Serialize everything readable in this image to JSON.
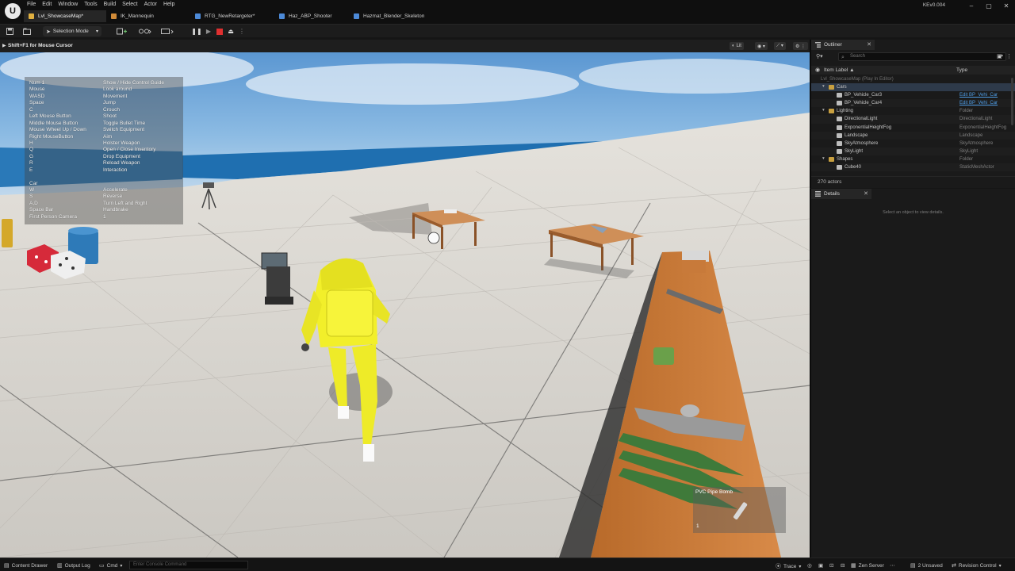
{
  "app": {
    "logo": "U",
    "version": "KEv0.004"
  },
  "menu": [
    "File",
    "Edit",
    "Window",
    "Tools",
    "Build",
    "Select",
    "Actor",
    "Help"
  ],
  "tabs": [
    {
      "label": "Lvl_ShowcaseMap*",
      "icon_color": "#e0b040"
    },
    {
      "label": "IK_Mannequin",
      "icon_color": "#d08a38"
    },
    {
      "label": "RTG_NewRetargeter*",
      "icon_color": "#4c8ad8"
    },
    {
      "label": "Haz_ABP_Shooter",
      "icon_color": "#4c8ad8"
    },
    {
      "label": "Hazmat_Blender_Skeleton",
      "icon_color": "#4c8ad8"
    }
  ],
  "window_controls": {
    "minimize": "–",
    "maximize": "▢",
    "close": "✕"
  },
  "toolbar": {
    "selection_mode": "Selection Mode"
  },
  "viewport": {
    "hint": "Shift+F1 for Mouse Cursor",
    "view_mode": "Lit"
  },
  "control_guide": [
    {
      "key": "Num 1",
      "action": "Show / Hide Control Guide"
    },
    {
      "key": "Mouse",
      "action": "Look around"
    },
    {
      "key": "WASD",
      "action": "Movement"
    },
    {
      "key": "Space",
      "action": "Jump"
    },
    {
      "key": "C",
      "action": "Crouch"
    },
    {
      "key": "Left Mouse Button",
      "action": "Shoot"
    },
    {
      "key": "Middle Mouse Button",
      "action": "Toggle Bullet Time"
    },
    {
      "key": "Mouse Wheel Up / Down",
      "action": "Switch Equipment"
    },
    {
      "key": "Right MouseButton",
      "action": "Aim"
    },
    {
      "key": "H",
      "action": "Holster Weapon"
    },
    {
      "key": "Q",
      "action": "Open / Close Inventory"
    },
    {
      "key": "G",
      "action": "Drop Equipment"
    },
    {
      "key": "R",
      "action": "Reload Weapon"
    },
    {
      "key": "E",
      "action": "Interaction"
    },
    {
      "key": "",
      "action": ""
    },
    {
      "key": "Car",
      "action": ""
    },
    {
      "key": "W",
      "action": "Accelerate"
    },
    {
      "key": "S",
      "action": "Reverse"
    },
    {
      "key": "A,D",
      "action": "Turn Left and Right"
    },
    {
      "key": "Space Bar",
      "action": "Handbrake"
    },
    {
      "key": "First Person Camera",
      "action": "1"
    }
  ],
  "pickup": {
    "name": "PVC Pipe Bomb",
    "count": "1"
  },
  "outliner": {
    "title": "Outliner",
    "search_placeholder": "Search",
    "col_label": "Item Label ▲",
    "col_type": "Type",
    "footer": "270 actors",
    "rows": [
      {
        "label": "Lvl_ShowcaseMap (Play In Editor)",
        "type": "",
        "indent": 0,
        "arrow": "",
        "icon": "",
        "dim": true
      },
      {
        "label": "Cars",
        "type": "",
        "indent": 1,
        "arrow": "▾",
        "icon": "#c8a040",
        "sel": true
      },
      {
        "label": "BP_Vehicle_Car3",
        "type": "Edit BP_Vehi_Car",
        "indent": 2,
        "arrow": "",
        "icon": "#bcbcbc",
        "link": true
      },
      {
        "label": "BP_Vehicle_Car4",
        "type": "Edit BP_Vehi_Car",
        "indent": 2,
        "arrow": "",
        "icon": "#bcbcbc",
        "link": true
      },
      {
        "label": "Lighting",
        "type": "Folder",
        "indent": 1,
        "arrow": "▾",
        "icon": "#c8a040"
      },
      {
        "label": "DirectionalLight",
        "type": "DirectionalLight",
        "indent": 2,
        "arrow": "",
        "icon": "#bcbcbc"
      },
      {
        "label": "ExponentialHeightFog",
        "type": "ExponentialHeightFog",
        "indent": 2,
        "arrow": "",
        "icon": "#bcbcbc"
      },
      {
        "label": "Landscape",
        "type": "Landscape",
        "indent": 2,
        "arrow": "",
        "icon": "#bcbcbc"
      },
      {
        "label": "SkyAtmosphere",
        "type": "SkyAtmosphere",
        "indent": 2,
        "arrow": "",
        "icon": "#bcbcbc"
      },
      {
        "label": "SkyLight",
        "type": "SkyLight",
        "indent": 2,
        "arrow": "",
        "icon": "#bcbcbc"
      },
      {
        "label": "Shapes",
        "type": "Folder",
        "indent": 1,
        "arrow": "▾",
        "icon": "#c8a040"
      },
      {
        "label": "Cube40",
        "type": "StaticMeshActor",
        "indent": 2,
        "arrow": "",
        "icon": "#bcbcbc"
      }
    ]
  },
  "details": {
    "title": "Details",
    "empty_text": "Select an object to view details."
  },
  "statusbar": {
    "content_drawer": "Content Drawer",
    "output_log": "Output Log",
    "cmd": "Cmd",
    "console_placeholder": "Enter Console Command",
    "trace": "Trace",
    "zen_server": "Zen Server",
    "unsaved": "2 Unsaved",
    "revision_control": "Revision Control"
  },
  "colors": {
    "accent_blue": "#4f9ee8",
    "stop_red": "#e03030",
    "hazmat_yellow": "#f2ef2a"
  }
}
